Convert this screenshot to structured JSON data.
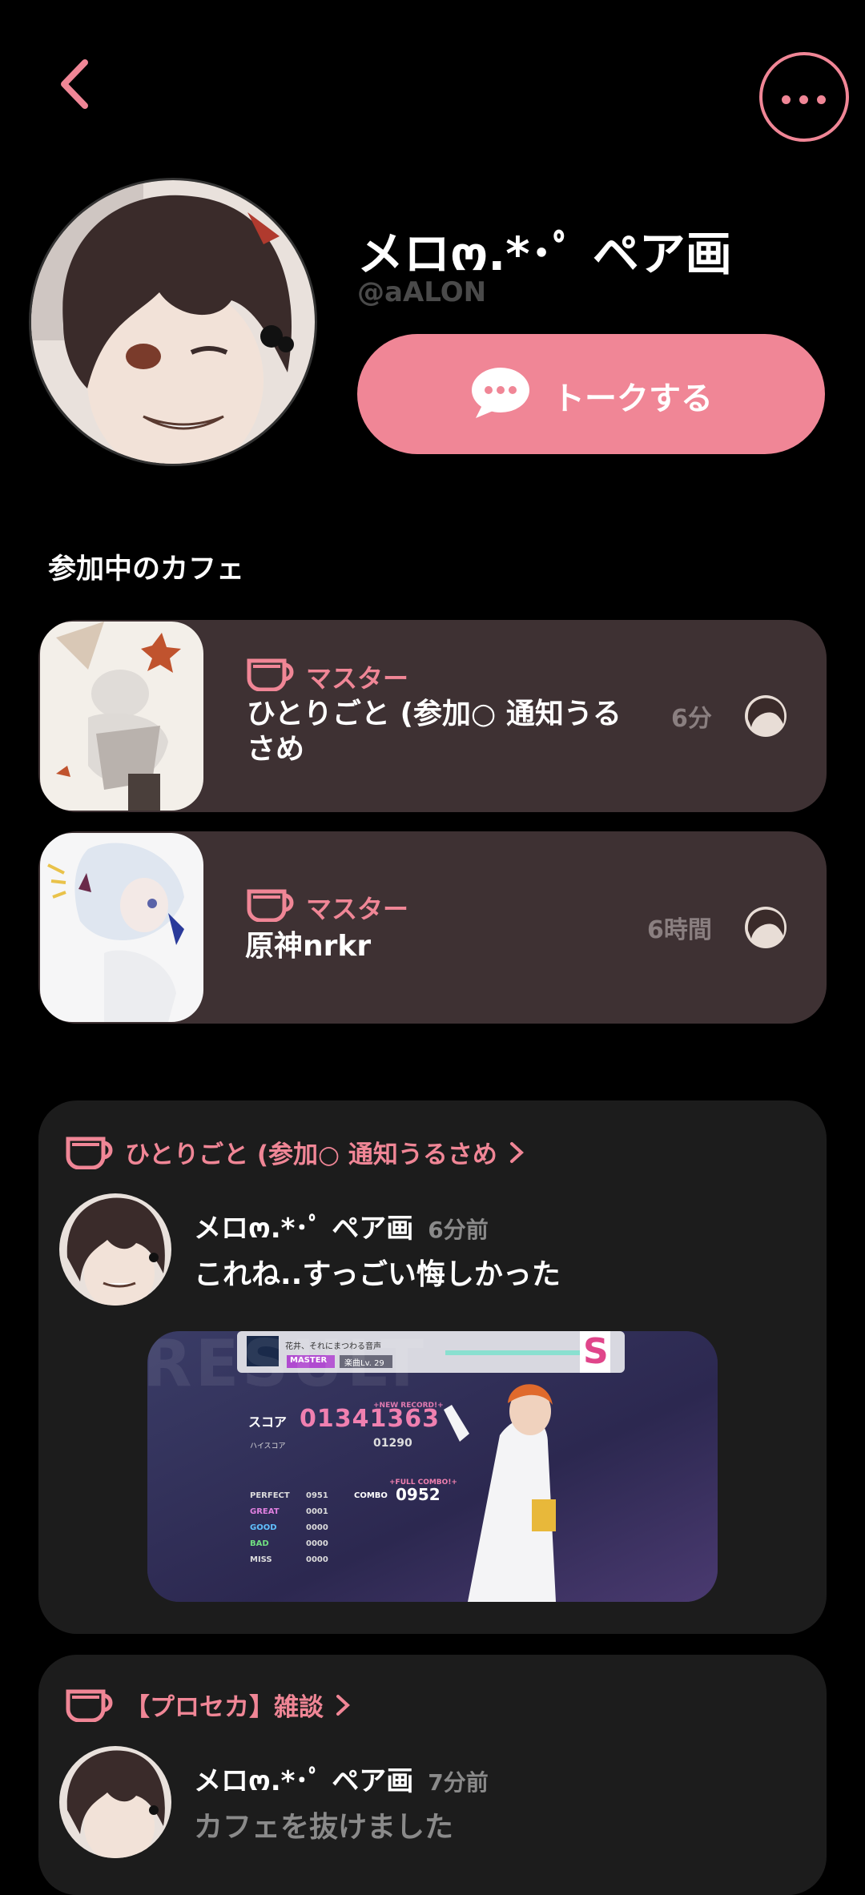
{
  "header": {
    "back_icon": "chevron-left-icon",
    "more_icon": "ellipsis-icon"
  },
  "profile": {
    "name": "メロო.*･ﾟ ペア画",
    "handle": "@aALON",
    "talk_button_label": "トークする"
  },
  "section_title": "参加中のカフェ",
  "cafes": [
    {
      "role": "マスター",
      "name_line1": "ひとりごと (参加○ 通知うる",
      "name_line2": "さめ",
      "time": "6分"
    },
    {
      "role": "マスター",
      "name_line1": "原神nrkr",
      "name_line2": "",
      "time": "6時間"
    }
  ],
  "posts": [
    {
      "cafe": "ひとりごと (参加○ 通知うるさめ",
      "author": "メロო.*･ﾟ ペア画",
      "time": "6分前",
      "text": "これね..すっごい悔しかった",
      "game": {
        "song": "花井、それにまつわる音声",
        "difficulty": "MASTER",
        "level": "楽曲Lv. 29",
        "rank": "S",
        "score_label": "スコア",
        "score": "01341363",
        "new_record": "+NEW RECORD!+",
        "hiscore_label": "ハイスコア",
        "hiscore": "01290",
        "full_combo": "+FULL COMBO!+",
        "combo_label": "COMBO",
        "combo": "0952",
        "judgements": [
          {
            "label": "PERFECT",
            "value": "0951"
          },
          {
            "label": "GREAT",
            "value": "0001"
          },
          {
            "label": "GOOD",
            "value": "0000"
          },
          {
            "label": "BAD",
            "value": "0000"
          },
          {
            "label": "MISS",
            "value": "0000"
          }
        ],
        "bg_text": "RESULT"
      }
    },
    {
      "cafe": "【プロセカ】雑談",
      "author": "メロო.*･ﾟ ペア画",
      "time": "7分前",
      "text": "カフェを抜けました"
    }
  ],
  "colors": {
    "accent": "#f08696",
    "card": "#3e3133",
    "post_card": "#1c1c1c"
  }
}
